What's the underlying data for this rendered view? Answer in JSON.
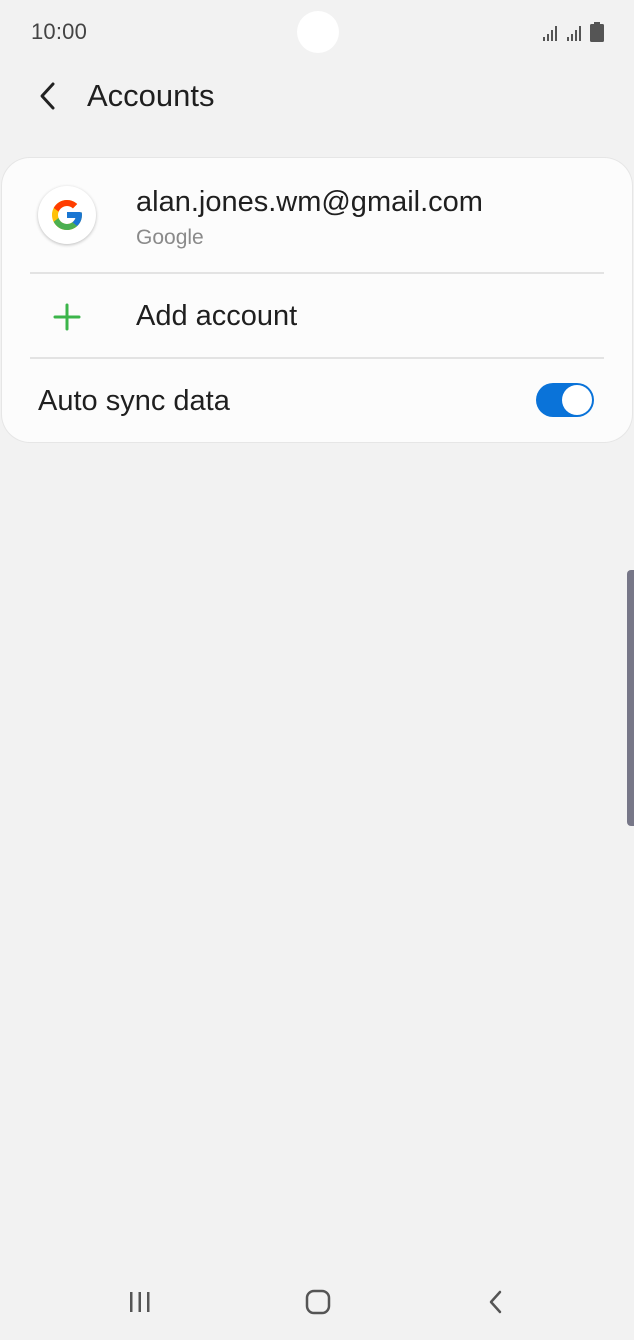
{
  "status_bar": {
    "time": "10:00",
    "icons": [
      "signal-icon",
      "signal-icon",
      "battery-icon"
    ]
  },
  "header": {
    "back_icon": "chevron-left-icon",
    "title": "Accounts"
  },
  "accounts": [
    {
      "icon": "google-icon",
      "email": "alan.jones.wm@gmail.com",
      "type": "Google"
    }
  ],
  "add_account": {
    "icon": "plus-icon",
    "label": "Add account",
    "icon_color": "#3bb54a"
  },
  "auto_sync": {
    "label": "Auto sync data",
    "enabled": true,
    "toggle_color": "#0a73d9"
  },
  "nav_bar": {
    "buttons": [
      "recents-icon",
      "home-icon",
      "back-icon"
    ]
  }
}
